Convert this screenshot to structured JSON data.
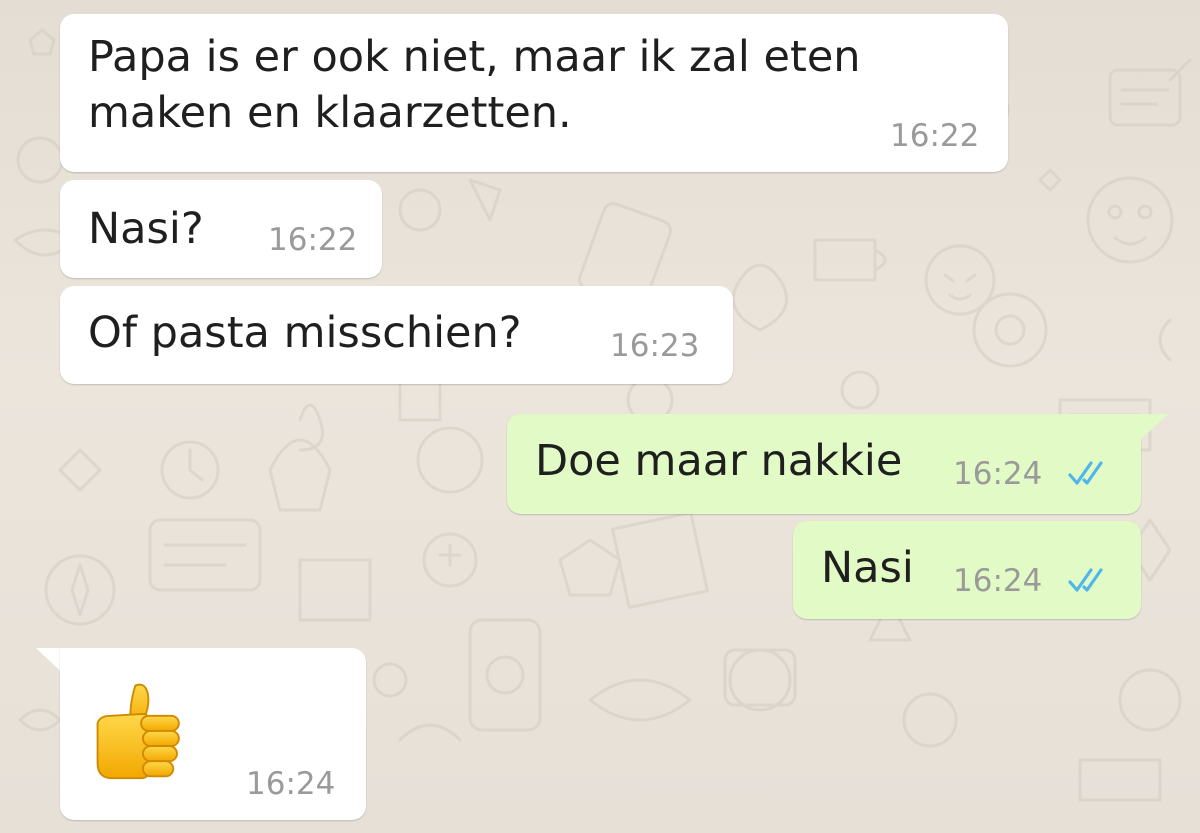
{
  "chat": {
    "theme": {
      "incoming_bubble": "#ffffff",
      "outgoing_bubble": "#e2fbc6",
      "timestamp_color": "#9a9a9a",
      "read_tick_color": "#4fb6ec"
    },
    "messages": [
      {
        "direction": "incoming",
        "lines": [
          "Papa is er ook niet, maar ik zal eten",
          "maken en klaarzetten."
        ],
        "time": "16:22"
      },
      {
        "direction": "incoming",
        "text": "Nasi?",
        "time": "16:22"
      },
      {
        "direction": "incoming",
        "text": "Of pasta misschien?",
        "time": "16:23"
      },
      {
        "direction": "outgoing",
        "text": "Doe maar nakkie",
        "time": "16:24",
        "status": "read",
        "status_icon": "double-check-icon"
      },
      {
        "direction": "outgoing",
        "text": "Nasi",
        "time": "16:24",
        "status": "read",
        "status_icon": "double-check-icon"
      },
      {
        "direction": "incoming",
        "emoji": "thumbs-up-emoji",
        "time": "16:24"
      }
    ]
  }
}
